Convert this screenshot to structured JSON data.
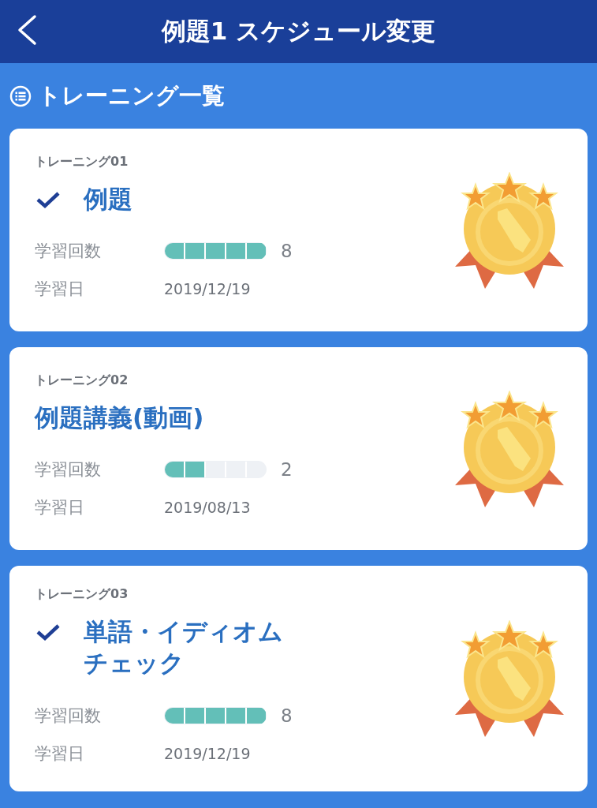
{
  "header": {
    "title": "例題1 スケジュール変更"
  },
  "section": {
    "title": "トレーニング一覧"
  },
  "trainings": [
    {
      "number": "トレーニング01",
      "completed": true,
      "title_lines": [
        "例題"
      ],
      "count_label": "学習回数",
      "level": 1.0,
      "count": "8",
      "date_label": "学習日",
      "date": "2019/12/19"
    },
    {
      "number": "トレーニング02",
      "completed": false,
      "title_lines": [
        "例題講義(動画)"
      ],
      "count_label": "学習回数",
      "level": 0.4,
      "count": "2",
      "date_label": "学習日",
      "date": "2019/08/13"
    },
    {
      "number": "トレーニング03",
      "completed": true,
      "title_lines": [
        "単語・イディオム",
        "チェック"
      ],
      "count_label": "学習回数",
      "level": 1.0,
      "count": "8",
      "date_label": "学習日",
      "date": "2019/12/19"
    }
  ]
}
